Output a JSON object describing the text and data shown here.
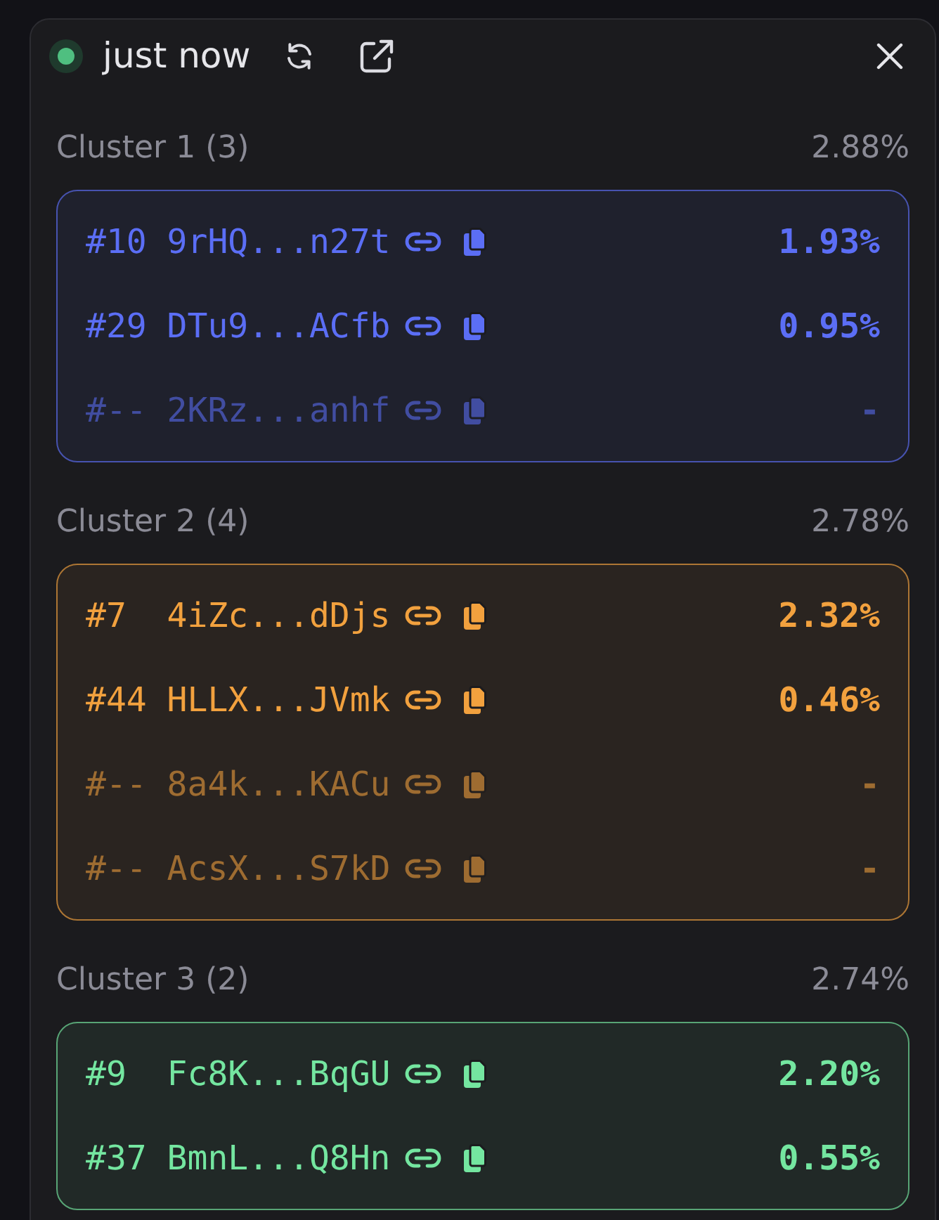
{
  "header": {
    "online": true,
    "status": "just now"
  },
  "clusters": [
    {
      "title": "Cluster 1 (3)",
      "share": "2.88%",
      "color": "#5b6ef5",
      "members": [
        {
          "rank": "#10",
          "address": "9rHQ...n27t",
          "share": "1.93%",
          "muted": false
        },
        {
          "rank": "#29",
          "address": "DTu9...ACfb",
          "share": "0.95%",
          "muted": false
        },
        {
          "rank": "#--",
          "address": "2KRz...anhf",
          "share": "-",
          "muted": true
        }
      ]
    },
    {
      "title": "Cluster 2 (4)",
      "share": "2.78%",
      "color": "#f2a13e",
      "members": [
        {
          "rank": "#7",
          "address": "4iZc...dDjs",
          "share": "2.32%",
          "muted": false
        },
        {
          "rank": "#44",
          "address": "HLLX...JVmk",
          "share": "0.46%",
          "muted": false
        },
        {
          "rank": "#--",
          "address": "8a4k...KACu",
          "share": "-",
          "muted": true
        },
        {
          "rank": "#--",
          "address": "AcsX...S7kD",
          "share": "-",
          "muted": true
        }
      ]
    },
    {
      "title": "Cluster 3 (2)",
      "share": "2.74%",
      "color": "#74e6a0",
      "members": [
        {
          "rank": "#9",
          "address": "Fc8K...BqGU",
          "share": "2.20%",
          "muted": false
        },
        {
          "rank": "#37",
          "address": "BmnL...Q8Hn",
          "share": "0.55%",
          "muted": false
        }
      ]
    }
  ]
}
